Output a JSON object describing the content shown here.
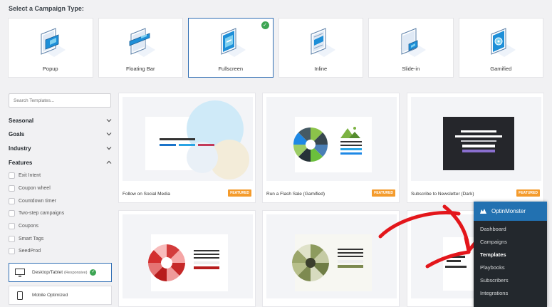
{
  "page": {
    "title": "Select a Campaign Type:"
  },
  "campaign_types": [
    {
      "label": "Popup",
      "icon": "popup-icon",
      "selected": false
    },
    {
      "label": "Floating Bar",
      "icon": "floating-bar-icon",
      "selected": false
    },
    {
      "label": "Fullscreen",
      "icon": "fullscreen-icon",
      "selected": true
    },
    {
      "label": "Inline",
      "icon": "inline-icon",
      "selected": false
    },
    {
      "label": "Slide-in",
      "icon": "slide-in-icon",
      "selected": false
    },
    {
      "label": "Gamified",
      "icon": "gamified-icon",
      "selected": false
    }
  ],
  "sidebar": {
    "search_placeholder": "Search Templates...",
    "sections": [
      {
        "label": "Seasonal",
        "expanded": false
      },
      {
        "label": "Goals",
        "expanded": false
      },
      {
        "label": "Industry",
        "expanded": false
      },
      {
        "label": "Features",
        "expanded": true
      }
    ],
    "features": [
      "Exit Intent",
      "Coupon wheel",
      "Countdown timer",
      "Two-step campaigns",
      "Coupons",
      "Smart Tags",
      "SeedProd"
    ],
    "devices": [
      {
        "label": "Desktop/Tablet",
        "note": "(Responsive)",
        "selected": true
      },
      {
        "label": "Mobile Optimized",
        "note": "",
        "selected": false
      }
    ]
  },
  "templates": [
    {
      "name": "Follow on Social Media",
      "badge": "FEATURED"
    },
    {
      "name": "Run a Flash Sale (Gamified)",
      "badge": "FEATURED"
    },
    {
      "name": "Subscribe to Newsletter (Dark)",
      "badge": "FEATURED"
    },
    {
      "name": "",
      "badge": ""
    },
    {
      "name": "",
      "badge": ""
    },
    {
      "name": "",
      "badge": ""
    }
  ],
  "wp_menu": {
    "title": "OptinMonster",
    "items": [
      {
        "label": "Dashboard",
        "active": false
      },
      {
        "label": "Campaigns",
        "active": false
      },
      {
        "label": "Templates",
        "active": true
      },
      {
        "label": "Playbooks",
        "active": false
      },
      {
        "label": "Subscribers",
        "active": false
      },
      {
        "label": "Integrations",
        "active": false
      }
    ]
  },
  "colors": {
    "accent": "#2f6db3",
    "featured": "#f49b2c",
    "check": "#3da553",
    "arrow": "#e3161b",
    "menu_bg": "#23282d",
    "menu_head": "#2271b1"
  }
}
